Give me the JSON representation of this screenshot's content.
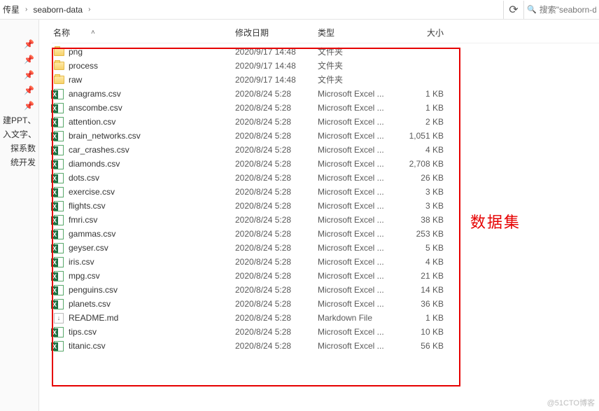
{
  "topbar": {
    "crumb1": "传星",
    "crumb2": "seaborn-data",
    "search_placeholder": "搜索\"seaborn-data\""
  },
  "sidebar_frags": [
    "建PPT、",
    "入文字、",
    "探系数",
    "统开发"
  ],
  "columns": {
    "name": "名称",
    "date": "修改日期",
    "type": "类型",
    "size": "大小"
  },
  "files": [
    {
      "icon": "folder",
      "name": "png",
      "date": "2020/9/17 14:48",
      "type": "文件夹",
      "size": ""
    },
    {
      "icon": "folder",
      "name": "process",
      "date": "2020/9/17 14:48",
      "type": "文件夹",
      "size": ""
    },
    {
      "icon": "folder",
      "name": "raw",
      "date": "2020/9/17 14:48",
      "type": "文件夹",
      "size": ""
    },
    {
      "icon": "excel",
      "name": "anagrams.csv",
      "date": "2020/8/24 5:28",
      "type": "Microsoft Excel ...",
      "size": "1 KB"
    },
    {
      "icon": "excel",
      "name": "anscombe.csv",
      "date": "2020/8/24 5:28",
      "type": "Microsoft Excel ...",
      "size": "1 KB"
    },
    {
      "icon": "excel",
      "name": "attention.csv",
      "date": "2020/8/24 5:28",
      "type": "Microsoft Excel ...",
      "size": "2 KB"
    },
    {
      "icon": "excel",
      "name": "brain_networks.csv",
      "date": "2020/8/24 5:28",
      "type": "Microsoft Excel ...",
      "size": "1,051 KB"
    },
    {
      "icon": "excel",
      "name": "car_crashes.csv",
      "date": "2020/8/24 5:28",
      "type": "Microsoft Excel ...",
      "size": "4 KB"
    },
    {
      "icon": "excel",
      "name": "diamonds.csv",
      "date": "2020/8/24 5:28",
      "type": "Microsoft Excel ...",
      "size": "2,708 KB"
    },
    {
      "icon": "excel",
      "name": "dots.csv",
      "date": "2020/8/24 5:28",
      "type": "Microsoft Excel ...",
      "size": "26 KB"
    },
    {
      "icon": "excel",
      "name": "exercise.csv",
      "date": "2020/8/24 5:28",
      "type": "Microsoft Excel ...",
      "size": "3 KB"
    },
    {
      "icon": "excel",
      "name": "flights.csv",
      "date": "2020/8/24 5:28",
      "type": "Microsoft Excel ...",
      "size": "3 KB"
    },
    {
      "icon": "excel",
      "name": "fmri.csv",
      "date": "2020/8/24 5:28",
      "type": "Microsoft Excel ...",
      "size": "38 KB"
    },
    {
      "icon": "excel",
      "name": "gammas.csv",
      "date": "2020/8/24 5:28",
      "type": "Microsoft Excel ...",
      "size": "253 KB"
    },
    {
      "icon": "excel",
      "name": "geyser.csv",
      "date": "2020/8/24 5:28",
      "type": "Microsoft Excel ...",
      "size": "5 KB"
    },
    {
      "icon": "excel",
      "name": "iris.csv",
      "date": "2020/8/24 5:28",
      "type": "Microsoft Excel ...",
      "size": "4 KB"
    },
    {
      "icon": "excel",
      "name": "mpg.csv",
      "date": "2020/8/24 5:28",
      "type": "Microsoft Excel ...",
      "size": "21 KB"
    },
    {
      "icon": "excel",
      "name": "penguins.csv",
      "date": "2020/8/24 5:28",
      "type": "Microsoft Excel ...",
      "size": "14 KB"
    },
    {
      "icon": "excel",
      "name": "planets.csv",
      "date": "2020/8/24 5:28",
      "type": "Microsoft Excel ...",
      "size": "36 KB"
    },
    {
      "icon": "md",
      "name": "README.md",
      "date": "2020/8/24 5:28",
      "type": "Markdown File",
      "size": "1 KB"
    },
    {
      "icon": "excel",
      "name": "tips.csv",
      "date": "2020/8/24 5:28",
      "type": "Microsoft Excel ...",
      "size": "10 KB"
    },
    {
      "icon": "excel",
      "name": "titanic.csv",
      "date": "2020/8/24 5:28",
      "type": "Microsoft Excel ...",
      "size": "56 KB"
    }
  ],
  "annotation": "数据集",
  "watermark": "@51CTO博客"
}
